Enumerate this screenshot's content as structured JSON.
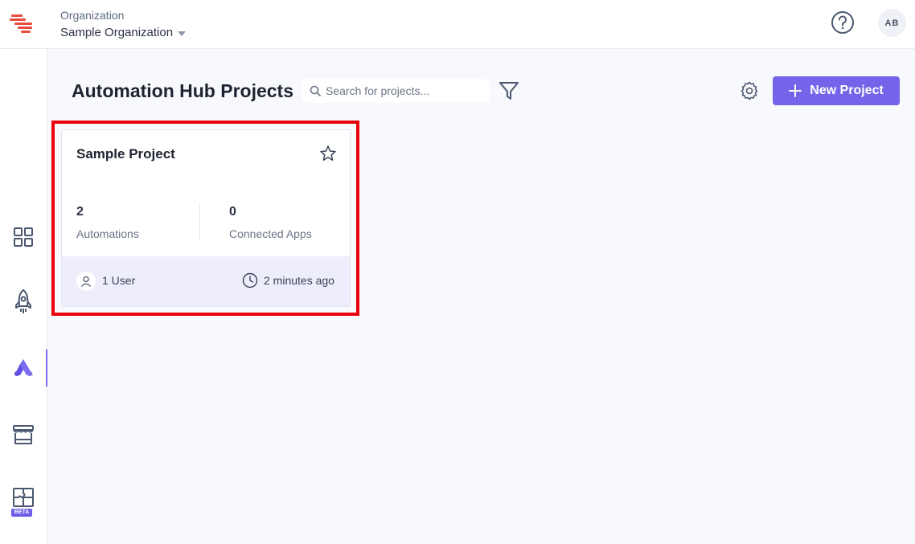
{
  "colors": {
    "accent": "#7464e9",
    "highlight": "#e8000b",
    "logo": "#e84c3d"
  },
  "header": {
    "org_label": "Organization",
    "org_name": "Sample Organization",
    "avatar_initials": "AB"
  },
  "sidebar": {
    "items": [
      {
        "name": "dashboard",
        "icon": "grid-icon"
      },
      {
        "name": "deploy",
        "icon": "rocket-icon"
      },
      {
        "name": "automation-hub",
        "icon": "automation-hub-icon",
        "active": true
      },
      {
        "name": "marketplace",
        "icon": "store-icon"
      },
      {
        "name": "integrations",
        "icon": "puzzle-icon",
        "badge": "BETA"
      }
    ]
  },
  "main": {
    "title": "Automation Hub Projects",
    "search_placeholder": "Search for projects...",
    "new_project_label": "New Project"
  },
  "project_card": {
    "title": "Sample Project",
    "stats": [
      {
        "value": "2",
        "label": "Automations"
      },
      {
        "value": "0",
        "label": "Connected Apps"
      }
    ],
    "users": "1 User",
    "updated": "2 minutes ago"
  }
}
